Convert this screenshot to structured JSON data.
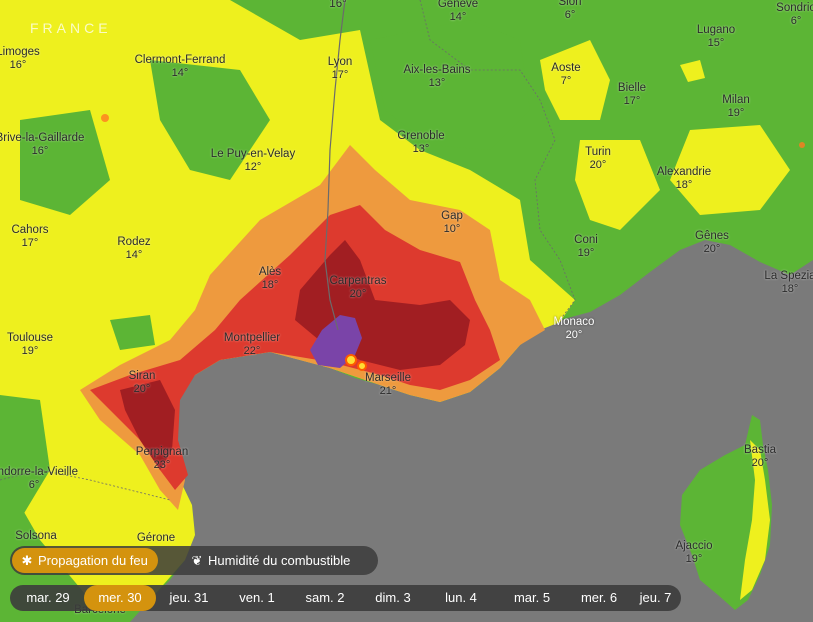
{
  "map": {
    "country_label": "FRANCE",
    "cities": [
      {
        "name": "16°",
        "temp": "",
        "light": false
      },
      {
        "name": "Genève",
        "temp": "14°",
        "light": false
      },
      {
        "name": "Sion",
        "temp": "6°",
        "light": false
      },
      {
        "name": "Sondrio",
        "temp": "6°",
        "light": false
      },
      {
        "name": "Lugano",
        "temp": "15°",
        "light": false
      },
      {
        "name": "Limoges",
        "temp": "16°",
        "light": false
      },
      {
        "name": "Clermont-Ferrand",
        "temp": "14°",
        "light": false
      },
      {
        "name": "Lyon",
        "temp": "17°",
        "light": false
      },
      {
        "name": "Aix-les-Bains",
        "temp": "13°",
        "light": false
      },
      {
        "name": "Aoste",
        "temp": "7°",
        "light": false
      },
      {
        "name": "Bielle",
        "temp": "17°",
        "light": false
      },
      {
        "name": "Milan",
        "temp": "19°",
        "light": false
      },
      {
        "name": "Brive-la-Gaillarde",
        "temp": "16°",
        "light": false
      },
      {
        "name": "Grenoble",
        "temp": "13°",
        "light": false
      },
      {
        "name": "Le Puy-en-Velay",
        "temp": "12°",
        "light": false
      },
      {
        "name": "Turin",
        "temp": "20°",
        "light": false
      },
      {
        "name": "Alexandrie",
        "temp": "18°",
        "light": false
      },
      {
        "name": "Cahors",
        "temp": "17°",
        "light": false
      },
      {
        "name": "Rodez",
        "temp": "14°",
        "light": false
      },
      {
        "name": "Gap",
        "temp": "10°",
        "light": false
      },
      {
        "name": "Coni",
        "temp": "19°",
        "light": false
      },
      {
        "name": "Gênes",
        "temp": "20°",
        "light": false
      },
      {
        "name": "Alès",
        "temp": "18°",
        "light": false
      },
      {
        "name": "Carpentras",
        "temp": "20°",
        "light": false
      },
      {
        "name": "La Spezia",
        "temp": "18°",
        "light": false
      },
      {
        "name": "Toulouse",
        "temp": "19°",
        "light": false
      },
      {
        "name": "Montpellier",
        "temp": "22°",
        "light": false
      },
      {
        "name": "Monaco",
        "temp": "20°",
        "light": true
      },
      {
        "name": "Siran",
        "temp": "20°",
        "light": false
      },
      {
        "name": "Marseille",
        "temp": "21°",
        "light": false
      },
      {
        "name": "Perpignan",
        "temp": "23°",
        "light": false
      },
      {
        "name": "Bastia",
        "temp": "20°",
        "light": false
      },
      {
        "name": "Andorre-la-Vieille",
        "temp": "6°",
        "light": false
      },
      {
        "name": "Solsona",
        "temp": "",
        "light": false
      },
      {
        "name": "Gérone",
        "temp": "",
        "light": false
      },
      {
        "name": "Ajaccio",
        "temp": "19°",
        "light": false
      },
      {
        "name": "Barcelone",
        "temp": "",
        "light": false
      }
    ],
    "colors": {
      "low": "#5cb535",
      "moderate": "#eef01e",
      "high": "#ee9a3e",
      "very_high": "#dd3a2e",
      "extreme": "#a11e22",
      "burned": "#7a44a8",
      "sea": "#7a7a7a",
      "accent": "#d4930e"
    }
  },
  "layers": {
    "fire_spread_label": "Propagation du feu",
    "fire_spread_icon": "flame-icon",
    "fuel_moisture_label": "Humidité du combustible",
    "fuel_moisture_icon": "leaf-icon",
    "active": "fire_spread"
  },
  "days": {
    "items": [
      "mar. 29",
      "mer. 30",
      "jeu. 31",
      "ven. 1",
      "sam. 2",
      "dim. 3",
      "lun. 4",
      "mar. 5",
      "mer. 6",
      "jeu. 7"
    ],
    "selected": "mer. 30"
  }
}
